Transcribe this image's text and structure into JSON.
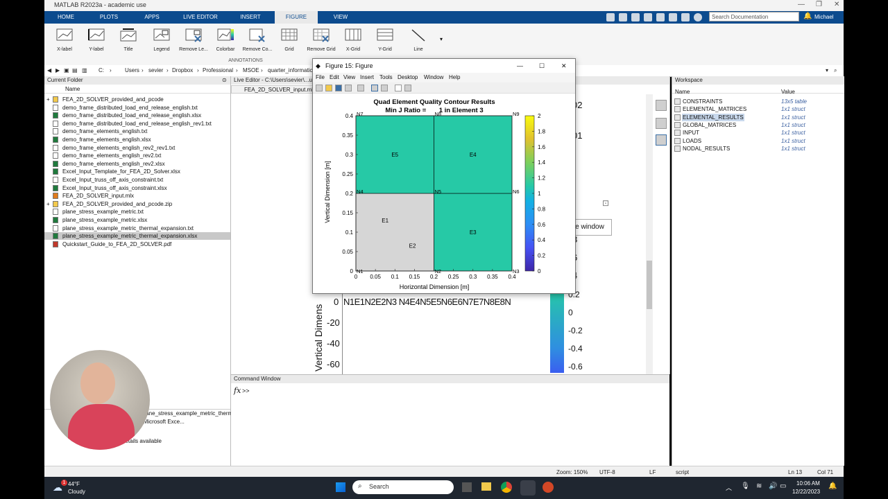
{
  "window": {
    "title": "MATLAB R2023a - academic use"
  },
  "ribbon_tabs": [
    {
      "label": "HOME"
    },
    {
      "label": "PLOTS"
    },
    {
      "label": "APPS"
    },
    {
      "label": "LIVE EDITOR"
    },
    {
      "label": "INSERT"
    },
    {
      "label": "FIGURE"
    },
    {
      "label": "VIEW"
    }
  ],
  "search_placeholder": "Search Documentation",
  "user": "Michael",
  "ribbon_buttons": [
    {
      "label": "X-label",
      "icon": "x-label-icon"
    },
    {
      "label": "Y-label",
      "icon": "y-label-icon"
    },
    {
      "label": "Title",
      "icon": "title-icon"
    },
    {
      "label": "Legend",
      "icon": "legend-icon"
    },
    {
      "label": "Remove Le...",
      "icon": "remove-legend-icon"
    },
    {
      "label": "Colorbar",
      "icon": "colorbar-icon"
    },
    {
      "label": "Remove Co...",
      "icon": "remove-colorbar-icon"
    },
    {
      "label": "Grid",
      "icon": "grid-icon"
    },
    {
      "label": "Remove Grid",
      "icon": "remove-grid-icon"
    },
    {
      "label": "X-Grid",
      "icon": "x-grid-icon"
    },
    {
      "label": "Y-Grid",
      "icon": "y-grid-icon"
    },
    {
      "label": "Line",
      "icon": "line-icon"
    }
  ],
  "annotations_label": "ANNOTATIONS",
  "address": [
    "C:",
    "Users",
    "sevier",
    "Dropbox",
    "Professional",
    "MSOE",
    "quarter_informatic"
  ],
  "current_folder": {
    "title": "Current Folder",
    "col_name": "Name",
    "files": [
      {
        "name": "FEA_2D_SOLVER_provided_and_pcode",
        "type": "folder"
      },
      {
        "name": "demo_frame_distributed_load_end_release_english.txt",
        "type": "txt"
      },
      {
        "name": "demo_frame_distributed_load_end_release_english.xlsx",
        "type": "xlsx"
      },
      {
        "name": "demo_frame_distributed_load_end_release_english_rev1.txt",
        "type": "txt"
      },
      {
        "name": "demo_frame_elements_english.txt",
        "type": "txt"
      },
      {
        "name": "demo_frame_elements_english.xlsx",
        "type": "xlsx"
      },
      {
        "name": "demo_frame_elements_english_rev2_rev1.txt",
        "type": "txt"
      },
      {
        "name": "demo_frame_elements_english_rev2.txt",
        "type": "txt"
      },
      {
        "name": "demo_frame_elements_english_rev2.xlsx",
        "type": "xlsx"
      },
      {
        "name": "Excel_Input_Template_for_FEA_2D_Solver.xlsx",
        "type": "xlsx"
      },
      {
        "name": "Excel_Input_truss_off_axis_constraint.txt",
        "type": "txt"
      },
      {
        "name": "Excel_Input_truss_off_axis_constraint.xlsx",
        "type": "xlsx"
      },
      {
        "name": "FEA_2D_SOLVER_input.mlx",
        "type": "mlx"
      },
      {
        "name": "FEA_2D_SOLVER_provided_and_pcode.zip",
        "type": "zip"
      },
      {
        "name": "plane_stress_example_metric.txt",
        "type": "txt"
      },
      {
        "name": "plane_stress_example_metric.xlsx",
        "type": "xlsx"
      },
      {
        "name": "plane_stress_example_metric_thermal_expansion.txt",
        "type": "txt"
      },
      {
        "name": "plane_stress_example_metric_thermal_expansion.xlsx",
        "type": "xlsx",
        "selected": true
      },
      {
        "name": "Quickstart_Guide_to_FEA_2D_SOLVER.pdf",
        "type": "pdf"
      }
    ],
    "details_file": "plane_stress_example_metric_thermal_expansion.xlsx (Microsoft Exce...",
    "details_text": "details available"
  },
  "editor": {
    "title": "Live Editor - C:\\Users\\sevier\\...ut.mlx",
    "tab": "FEA_2D_SOLVER_input.mlx",
    "bg_right_numbers": [
      "02",
      "01",
      "8",
      "6",
      "4"
    ],
    "bg_colorbar_ticks": [
      "0.2",
      "0",
      "-0.2",
      "-0.4",
      "-0.6"
    ],
    "bg_y_ticks": [
      "0",
      "-20",
      "-40",
      "-60"
    ],
    "bg_ylabel": "Vertical Dimens",
    "bg_nodes": "N1E1N2E2N3 N4E4N5E5N6E6N7E7N8E8N",
    "tooltip": "e window"
  },
  "command_window": {
    "title": "Command Window",
    "prompt": ">>"
  },
  "workspace": {
    "title": "Workspace",
    "col_name": "Name",
    "col_value": "Value",
    "vars": [
      {
        "name": "CONSTRAINTS",
        "value": "13x5 table"
      },
      {
        "name": "ELEMENTAL_MATRICES",
        "value": "1x1 struct"
      },
      {
        "name": "ELEMENTAL_RESULTS",
        "value": "1x1 struct",
        "selected": true
      },
      {
        "name": "GLOBAL_MATRICES",
        "value": "1x1 struct"
      },
      {
        "name": "INPUT",
        "value": "1x1 struct"
      },
      {
        "name": "LOADS",
        "value": "1x1 struct"
      },
      {
        "name": "NODAL_RESULTS",
        "value": "1x1 struct"
      }
    ]
  },
  "status": {
    "zoom": "Zoom: 150%",
    "encoding": "UTF-8",
    "eol": "LF",
    "mode": "script",
    "ln": "Ln  13",
    "col": "Col  71"
  },
  "figure": {
    "title": "Figure 15: Figure",
    "menu": [
      "File",
      "Edit",
      "View",
      "Insert",
      "Tools",
      "Desktop",
      "Window",
      "Help"
    ]
  },
  "taskbar": {
    "temp": "44°F",
    "weather": "Cloudy",
    "search": "Search",
    "time": "10:06 AM",
    "date": "12/22/2023",
    "badge": "1"
  },
  "colors": {
    "ribbon_blue": "#0c4b8e",
    "element_teal": "#26c9a6",
    "element_gray": "#d6d6d6"
  },
  "chart_data": {
    "type": "heatmap",
    "title": "Quad Element Quality Contour Results",
    "subtitle": "Min J Ratio =       1 in Element 3",
    "xlabel": "Horizontal Dimension [m]",
    "ylabel": "Vertical Dimension [m]",
    "xlim": [
      0,
      0.4
    ],
    "ylim": [
      0,
      0.4
    ],
    "xticks": [
      "0",
      "0.05",
      "0.1",
      "0.15",
      "0.2",
      "0.25",
      "0.3",
      "0.35",
      "0.4"
    ],
    "yticks": [
      "0",
      "0.05",
      "0.1",
      "0.15",
      "0.2",
      "0.25",
      "0.3",
      "0.35",
      "0.4"
    ],
    "colorbar": {
      "min": 0,
      "max": 2,
      "ticks": [
        "0",
        "0.2",
        "0.4",
        "0.6",
        "0.8",
        "1",
        "1.2",
        "1.4",
        "1.6",
        "1.8",
        "2"
      ]
    },
    "elements": [
      {
        "label": "E1",
        "x0": 0,
        "y0": 0,
        "x1": 0.2,
        "y1": 0.2,
        "color": "#d6d6d6"
      },
      {
        "label": "E2",
        "x0": 0,
        "y0": 0,
        "x1": 0.2,
        "y1": 0.2,
        "color": "#d6d6d6"
      },
      {
        "label": "E3",
        "x0": 0.2,
        "y0": 0,
        "x1": 0.4,
        "y1": 0.2,
        "color": "#26c9a6"
      },
      {
        "label": "E4",
        "x0": 0.2,
        "y0": 0.2,
        "x1": 0.4,
        "y1": 0.4,
        "color": "#26c9a6"
      },
      {
        "label": "E5",
        "x0": 0,
        "y0": 0.2,
        "x1": 0.2,
        "y1": 0.4,
        "color": "#26c9a6"
      }
    ],
    "element_labels": [
      {
        "label": "E1",
        "x": 0.075,
        "y": 0.13
      },
      {
        "label": "E2",
        "x": 0.145,
        "y": 0.065
      },
      {
        "label": "E3",
        "x": 0.3,
        "y": 0.1
      },
      {
        "label": "E4",
        "x": 0.3,
        "y": 0.3
      },
      {
        "label": "E5",
        "x": 0.1,
        "y": 0.3
      }
    ],
    "nodes": [
      {
        "label": "N1",
        "x": 0,
        "y": 0
      },
      {
        "label": "N2",
        "x": 0.2,
        "y": 0
      },
      {
        "label": "N3",
        "x": 0.4,
        "y": 0
      },
      {
        "label": "N4",
        "x": 0,
        "y": 0.2
      },
      {
        "label": "N5",
        "x": 0.2,
        "y": 0.2
      },
      {
        "label": "N6",
        "x": 0.4,
        "y": 0.2
      },
      {
        "label": "N7",
        "x": 0,
        "y": 0.4
      },
      {
        "label": "N8",
        "x": 0.2,
        "y": 0.4
      },
      {
        "label": "N9",
        "x": 0.4,
        "y": 0.4
      }
    ]
  }
}
